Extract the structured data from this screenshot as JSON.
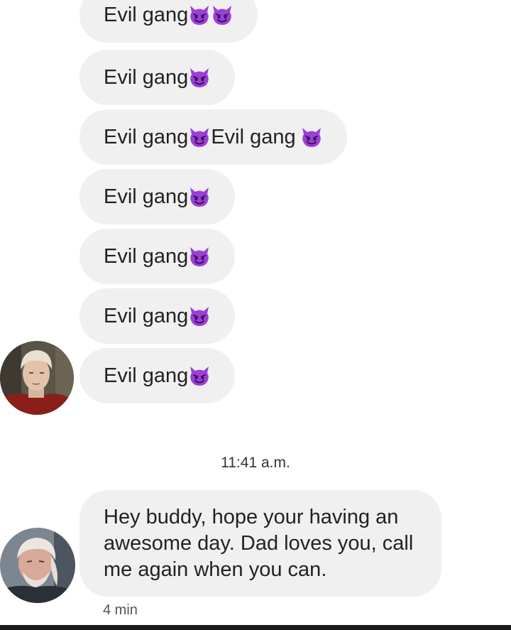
{
  "messages": [
    {
      "text": "Evil gang",
      "emoji": [
        "smiling-imp-icon",
        "smiling-imp-icon"
      ]
    },
    {
      "text": "Evil gang",
      "emoji": [
        "smiling-imp-icon"
      ]
    },
    {
      "text": "Evil gang",
      "emoji": [
        "smiling-imp-icon"
      ],
      "text2": "Evil gang",
      "emoji2": [
        "smiling-imp-icon"
      ]
    },
    {
      "text": "Evil gang",
      "emoji": [
        "smiling-imp-icon"
      ]
    },
    {
      "text": "Evil gang",
      "emoji": [
        "smiling-imp-icon"
      ]
    },
    {
      "text": "Evil gang",
      "emoji": [
        "smiling-imp-icon"
      ]
    },
    {
      "text": "Evil gang",
      "emoji": [
        "smiling-imp-icon"
      ]
    }
  ],
  "timestamp": "11:41 a.m.",
  "last_message": {
    "text": "Hey buddy, hope your having an awesome day. Dad loves you, call me again when you can.",
    "time_ago": "4 min"
  },
  "colors": {
    "bubble": "#f0f0f0",
    "emoji": "#9b3fd6",
    "text": "#222222"
  }
}
